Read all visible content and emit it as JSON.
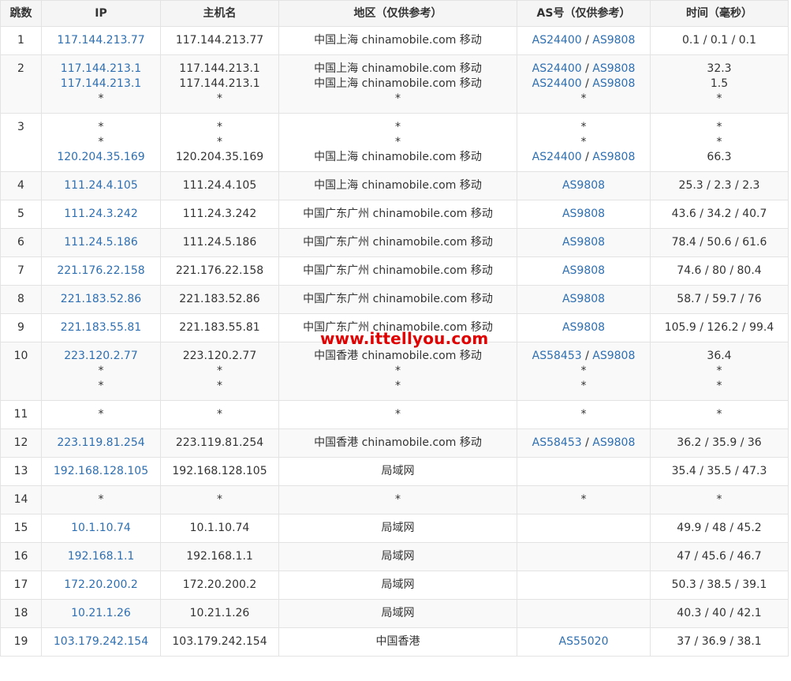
{
  "headers": {
    "hop": "跳数",
    "ip": "IP",
    "hostname": "主机名",
    "region": "地区（仅供参考）",
    "as": "AS号（仅供参考）",
    "time": "时间（毫秒）"
  },
  "watermark": "www.ittellyou.com",
  "hops": [
    {
      "hop": "1",
      "lines": [
        {
          "ip": "117.144.213.77",
          "host": "117.144.213.77",
          "region": "中国上海 chinamobile.com 移动",
          "as": [
            "AS24400",
            "AS9808"
          ],
          "time": "0.1 / 0.1 / 0.1"
        }
      ]
    },
    {
      "hop": "2",
      "lines": [
        {
          "ip": "117.144.213.1",
          "host": "117.144.213.1",
          "region": "中国上海 chinamobile.com 移动",
          "as": [
            "AS24400",
            "AS9808"
          ],
          "time": "32.3"
        },
        {
          "ip": "117.144.213.1",
          "host": "117.144.213.1",
          "region": "中国上海 chinamobile.com 移动",
          "as": [
            "AS24400",
            "AS9808"
          ],
          "time": "1.5"
        },
        {
          "ip": "*",
          "host": "*",
          "region": "*",
          "as": [
            "*"
          ],
          "time": "*"
        }
      ]
    },
    {
      "hop": "3",
      "lines": [
        {
          "ip": "*",
          "host": "*",
          "region": "*",
          "as": [
            "*"
          ],
          "time": "*"
        },
        {
          "ip": "*",
          "host": "*",
          "region": "*",
          "as": [
            "*"
          ],
          "time": "*"
        },
        {
          "ip": "120.204.35.169",
          "host": "120.204.35.169",
          "region": "中国上海 chinamobile.com 移动",
          "as": [
            "AS24400",
            "AS9808"
          ],
          "time": "66.3"
        }
      ]
    },
    {
      "hop": "4",
      "lines": [
        {
          "ip": "111.24.4.105",
          "host": "111.24.4.105",
          "region": "中国上海 chinamobile.com 移动",
          "as": [
            "AS9808"
          ],
          "time": "25.3 / 2.3 / 2.3"
        }
      ]
    },
    {
      "hop": "5",
      "lines": [
        {
          "ip": "111.24.3.242",
          "host": "111.24.3.242",
          "region": "中国广东广州 chinamobile.com 移动",
          "as": [
            "AS9808"
          ],
          "time": "43.6 / 34.2 / 40.7"
        }
      ]
    },
    {
      "hop": "6",
      "lines": [
        {
          "ip": "111.24.5.186",
          "host": "111.24.5.186",
          "region": "中国广东广州 chinamobile.com 移动",
          "as": [
            "AS9808"
          ],
          "time": "78.4 / 50.6 / 61.6"
        }
      ]
    },
    {
      "hop": "7",
      "lines": [
        {
          "ip": "221.176.22.158",
          "host": "221.176.22.158",
          "region": "中国广东广州 chinamobile.com 移动",
          "as": [
            "AS9808"
          ],
          "time": "74.6 / 80 / 80.4"
        }
      ]
    },
    {
      "hop": "8",
      "lines": [
        {
          "ip": "221.183.52.86",
          "host": "221.183.52.86",
          "region": "中国广东广州 chinamobile.com 移动",
          "as": [
            "AS9808"
          ],
          "time": "58.7 / 59.7 / 76"
        }
      ]
    },
    {
      "hop": "9",
      "lines": [
        {
          "ip": "221.183.55.81",
          "host": "221.183.55.81",
          "region": "中国广东广州 chinamobile.com 移动",
          "as": [
            "AS9808"
          ],
          "time": "105.9 / 126.2 / 99.4"
        }
      ]
    },
    {
      "hop": "10",
      "lines": [
        {
          "ip": "223.120.2.77",
          "host": "223.120.2.77",
          "region": "中国香港 chinamobile.com 移动",
          "as": [
            "AS58453",
            "AS9808"
          ],
          "time": "36.4"
        },
        {
          "ip": "*",
          "host": "*",
          "region": "*",
          "as": [
            "*"
          ],
          "time": "*"
        },
        {
          "ip": "*",
          "host": "*",
          "region": "*",
          "as": [
            "*"
          ],
          "time": "*"
        }
      ]
    },
    {
      "hop": "11",
      "lines": [
        {
          "ip": "*",
          "host": "*",
          "region": "*",
          "as": [
            "*"
          ],
          "time": "*"
        }
      ]
    },
    {
      "hop": "12",
      "lines": [
        {
          "ip": "223.119.81.254",
          "host": "223.119.81.254",
          "region": "中国香港 chinamobile.com 移动",
          "as": [
            "AS58453",
            "AS9808"
          ],
          "time": "36.2 / 35.9 / 36"
        }
      ]
    },
    {
      "hop": "13",
      "lines": [
        {
          "ip": "192.168.128.105",
          "host": "192.168.128.105",
          "region": "局域网",
          "as": [],
          "time": "35.4 / 35.5 / 47.3"
        }
      ]
    },
    {
      "hop": "14",
      "lines": [
        {
          "ip": "*",
          "host": "*",
          "region": "*",
          "as": [
            "*"
          ],
          "time": "*"
        }
      ]
    },
    {
      "hop": "15",
      "lines": [
        {
          "ip": "10.1.10.74",
          "host": "10.1.10.74",
          "region": "局域网",
          "as": [],
          "time": "49.9 / 48 / 45.2"
        }
      ]
    },
    {
      "hop": "16",
      "lines": [
        {
          "ip": "192.168.1.1",
          "host": "192.168.1.1",
          "region": "局域网",
          "as": [],
          "time": "47 / 45.6 / 46.7"
        }
      ]
    },
    {
      "hop": "17",
      "lines": [
        {
          "ip": "172.20.200.2",
          "host": "172.20.200.2",
          "region": "局域网",
          "as": [],
          "time": "50.3 / 38.5 / 39.1"
        }
      ]
    },
    {
      "hop": "18",
      "lines": [
        {
          "ip": "10.21.1.26",
          "host": "10.21.1.26",
          "region": "局域网",
          "as": [],
          "time": "40.3 / 40 / 42.1"
        }
      ]
    },
    {
      "hop": "19",
      "lines": [
        {
          "ip": "103.179.242.154",
          "host": "103.179.242.154",
          "region": "中国香港",
          "as": [
            "AS55020"
          ],
          "time": "37 / 36.9 / 38.1"
        }
      ]
    }
  ],
  "colors": {
    "link": "#2e6fb2",
    "header_bg": "#f5f5f5",
    "alt_row_bg": "#f9f9f9",
    "border": "#e3e3e3",
    "watermark": "#e00000"
  }
}
